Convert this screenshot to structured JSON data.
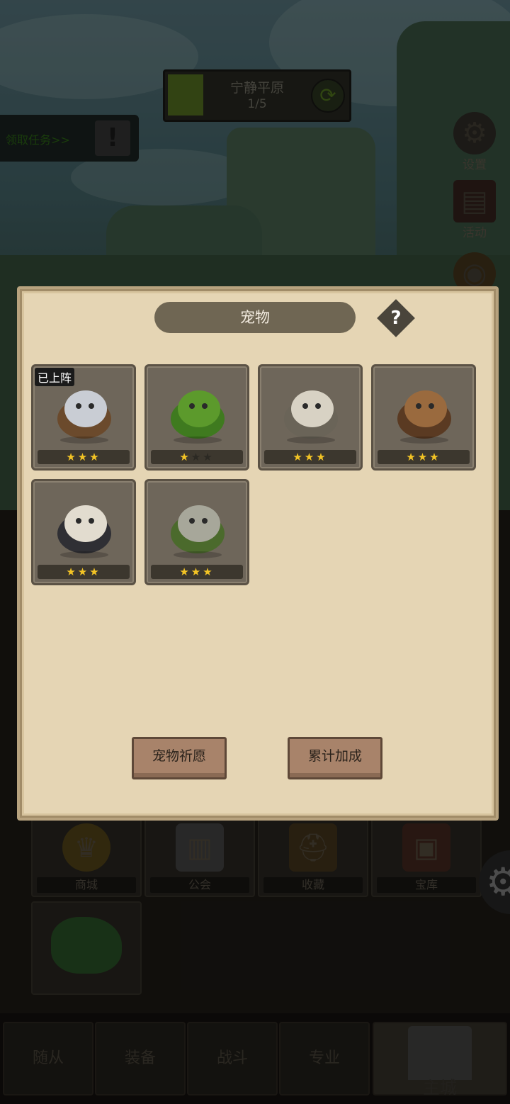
{
  "stage": {
    "name": "宁静平原",
    "progress": "1/5"
  },
  "quest": {
    "label": "领取任务>>",
    "alert": "!"
  },
  "side_menu": [
    {
      "label": "设置",
      "icon": "gear-icon"
    },
    {
      "label": "活动",
      "icon": "scroll-icon"
    }
  ],
  "dialog": {
    "title": "宠物",
    "help": "?",
    "pets": [
      {
        "name": "griffin",
        "stars": 3,
        "max_stars": 3,
        "badge": "已上阵",
        "colors": [
          "#c9cdd4",
          "#6b4a2c"
        ]
      },
      {
        "name": "green-dragonling",
        "stars": 1,
        "max_stars": 3,
        "badge": "",
        "colors": [
          "#5c9a2c",
          "#3f7a1f"
        ]
      },
      {
        "name": "stone-golem-light",
        "stars": 3,
        "max_stars": 3,
        "badge": "",
        "colors": [
          "#d8d2c4",
          "#6a6458"
        ]
      },
      {
        "name": "boar",
        "stars": 3,
        "max_stars": 3,
        "badge": "",
        "colors": [
          "#9a6a3e",
          "#5a3a22"
        ]
      },
      {
        "name": "fennec-fox",
        "stars": 3,
        "max_stars": 3,
        "badge": "",
        "colors": [
          "#e2dccf",
          "#2f2f34"
        ]
      },
      {
        "name": "stone-golem-moss",
        "stars": 3,
        "max_stars": 3,
        "badge": "",
        "colors": [
          "#a7a79a",
          "#4b6a2c"
        ]
      }
    ],
    "buttons": {
      "wish": "宠物祈愿",
      "bonus": "累计加成"
    }
  },
  "buildings": [
    {
      "label": "商城",
      "icon": "coin-icon"
    },
    {
      "label": "公会",
      "icon": "guild-icon"
    },
    {
      "label": "收藏",
      "icon": "helmet-icon"
    },
    {
      "label": "宝库",
      "icon": "vault-icon"
    }
  ],
  "tabs": [
    {
      "label": "随从"
    },
    {
      "label": "装备"
    },
    {
      "label": "战斗"
    },
    {
      "label": "专业"
    },
    {
      "label": "主城",
      "active": true
    }
  ]
}
